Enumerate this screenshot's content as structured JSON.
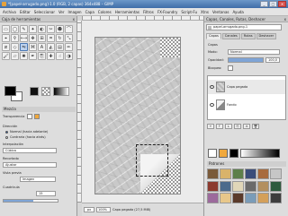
{
  "window": {
    "title": "*[papel-arrugado.png]-1.0 (RGB, 2 capas) 364x488 – GIMP",
    "min": "_",
    "max": "□",
    "close": "✕"
  },
  "menu": [
    "Archivo",
    "Editar",
    "Seleccionar",
    "Ver",
    "Imagen",
    "Capa",
    "Colores",
    "Herramientas",
    "Filtros",
    "FX-Foundry",
    "Script-Fu",
    "Xtns",
    "Ventanas",
    "Ayuda"
  ],
  "toolbox": {
    "title": "Caja de herramientas",
    "close": "x",
    "tool_icons": [
      "rect-select-icon",
      "ellipse-select-icon",
      "free-select-icon",
      "fuzzy-select-icon",
      "color-select-icon",
      "scissors-select-icon",
      "foreground-select-icon",
      "paths-icon",
      "color-picker-icon",
      "zoom-icon",
      "measure-icon",
      "move-icon",
      "align-icon",
      "crop-icon",
      "rotate-icon",
      "scale-icon",
      "shear-icon",
      "perspective-icon",
      "flip-icon",
      "cage-icon",
      "text-icon",
      "bucket-fill-icon",
      "blend-icon",
      "pencil-icon",
      "paintbrush-icon",
      "eraser-icon",
      "airbrush-icon",
      "ink-icon",
      "clone-icon",
      "heal-icon",
      "smudge-icon",
      "dodge-burn-icon"
    ],
    "tool_glyphs": [
      "▭",
      "◯",
      "✎",
      "✦",
      "◐",
      "✂",
      "☻",
      "⌒",
      "⌖",
      "⚲",
      "⟷",
      "✥",
      "⊞",
      "⌗",
      "↻",
      "⤡",
      "⧄",
      "◇",
      "⇋",
      "⌘",
      "A",
      "◭",
      "▤",
      "✏",
      "🖌",
      "▱",
      "✺",
      "✒",
      "⎘",
      "✚",
      "☝",
      "◑"
    ],
    "options_title": "Mezcla",
    "mode_label": "Transparencia",
    "opacity_label": "Opacidad",
    "direction_label": "Dirección",
    "radio1": "Normal (hacia adelante)",
    "radio2": "Contraria (hacia atrás)",
    "interp_label": "Interpolación",
    "interp_value": "Cúbica",
    "recorte_label": "Recortado",
    "recorte_value": "Ajustar",
    "preview_label": "Vista previa",
    "preview_value": "Imagen",
    "grid_label": "Cuadrícula",
    "grid_value": "15"
  },
  "canvas": {
    "unit": "px",
    "zoom": "100%",
    "status": "Capa pegada (27,5 MiB)"
  },
  "rdock": {
    "title": "Capas, Canales, Rutas, Deshacer",
    "close": "x",
    "image_select": "papel-arrugado.png-1",
    "tabs": [
      "Capas",
      "Canales",
      "Rutas",
      "Deshacer"
    ],
    "section": "Capas",
    "mode_label": "Modo:",
    "mode_value": "Normal",
    "opacity_label": "Opacidad:",
    "opacity_value": "100,0",
    "lock_label": "Bloqueo:",
    "layers": [
      {
        "name": "Capa pegada"
      },
      {
        "name": "Fondo"
      }
    ],
    "layer_buttons": [
      "+",
      "↑",
      "↓",
      "⎘",
      "⚓",
      "🗑"
    ],
    "patterns_title": "Patrones",
    "pattern_colors": [
      "#7a5a3a",
      "#d9b36a",
      "#5d7f4a",
      "#3a4d7a",
      "#a86b3d",
      "#c6c6c6",
      "#8c3a2e",
      "#4c6b8c",
      "#e0d6b8",
      "#6a6a6a",
      "#b38f5f",
      "#2d5a3d",
      "#9c6a9c",
      "#e8c78a",
      "#5a3a2a",
      "#7a9cb8",
      "#d4a05a",
      "#3d3d3d"
    ]
  }
}
